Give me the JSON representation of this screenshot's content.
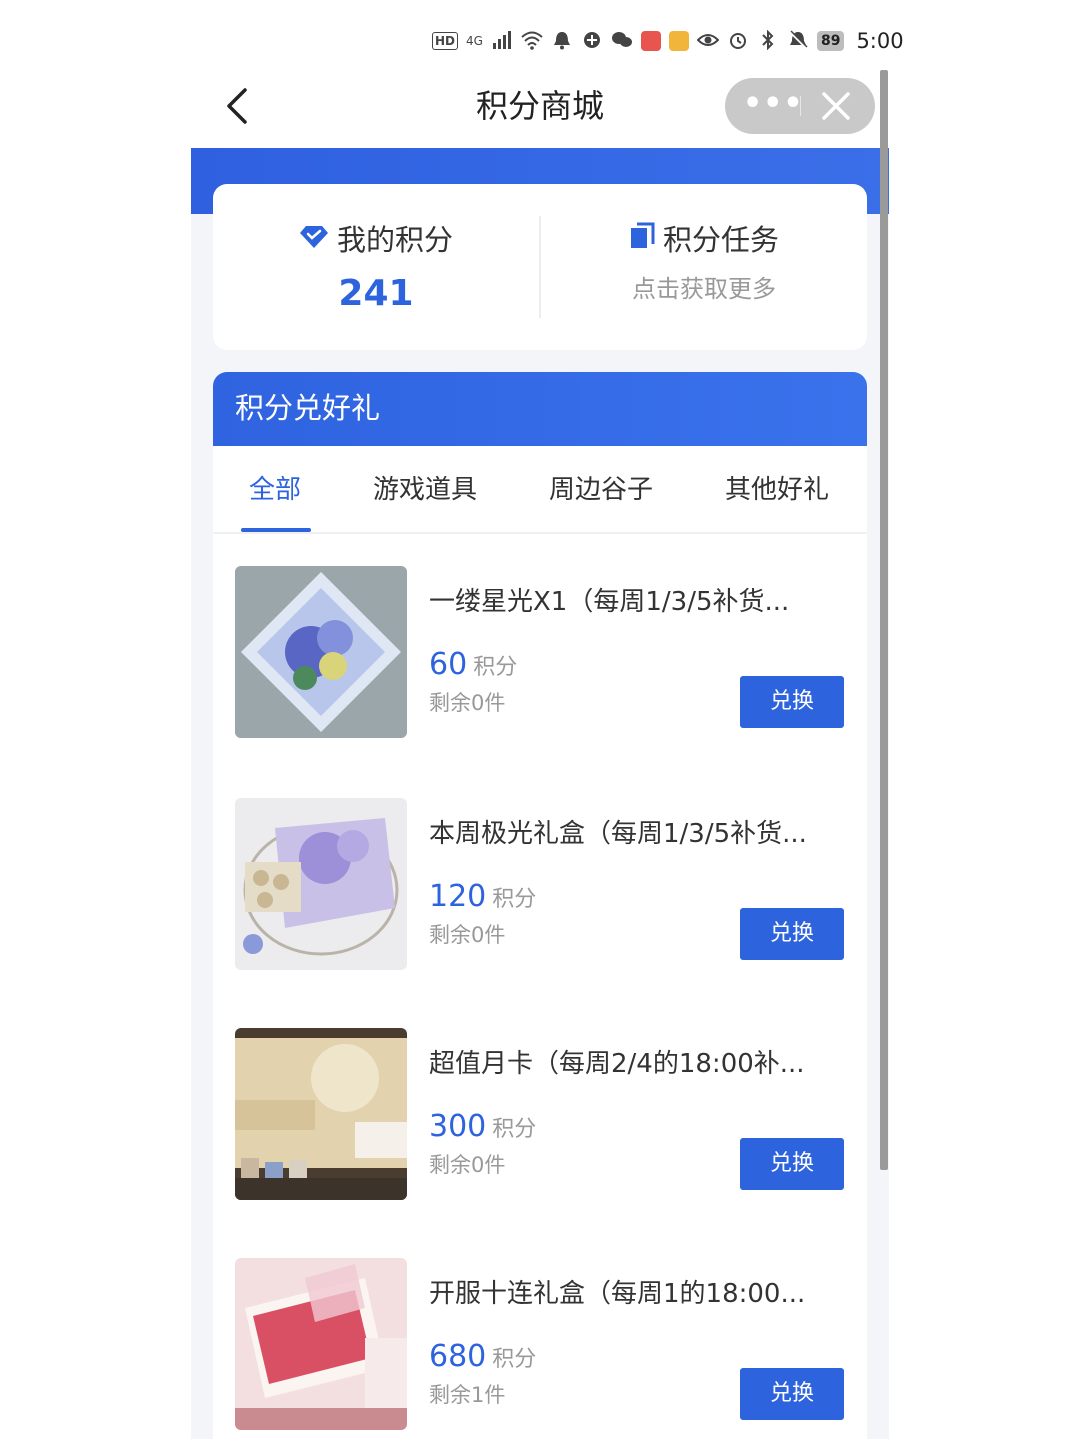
{
  "status_bar": {
    "hd": "HD",
    "network": "4G",
    "battery": "89",
    "time": "5:00"
  },
  "nav": {
    "title": "积分商城",
    "more": "•••"
  },
  "points": {
    "my_points_label": "我的积分",
    "my_points_value": "241",
    "tasks_label": "积分任务",
    "tasks_sub": "点击获取更多"
  },
  "exchange": {
    "title": "积分兑好礼",
    "tabs": [
      {
        "label": "全部",
        "active": true
      },
      {
        "label": "游戏道具",
        "active": false
      },
      {
        "label": "周边谷子",
        "active": false
      },
      {
        "label": "其他好礼",
        "active": false
      }
    ],
    "products": [
      {
        "title": "一缕星光X1（每周1/3/5补货...",
        "price": "60",
        "unit": "积分",
        "stock": "剩余0件",
        "button": "兑换"
      },
      {
        "title": "本周极光礼盒（每周1/3/5补货...",
        "price": "120",
        "unit": "积分",
        "stock": "剩余0件",
        "button": "兑换"
      },
      {
        "title": "超值月卡（每周2/4的18:00补...",
        "price": "300",
        "unit": "积分",
        "stock": "剩余0件",
        "button": "兑换"
      },
      {
        "title": "开服十连礼盒（每周1的18:00...",
        "price": "680",
        "unit": "积分",
        "stock": "剩余1件",
        "button": "兑换"
      }
    ]
  },
  "colors": {
    "accent": "#2e63de",
    "banner": "#3a72ec",
    "background": "#f4f5f9"
  }
}
